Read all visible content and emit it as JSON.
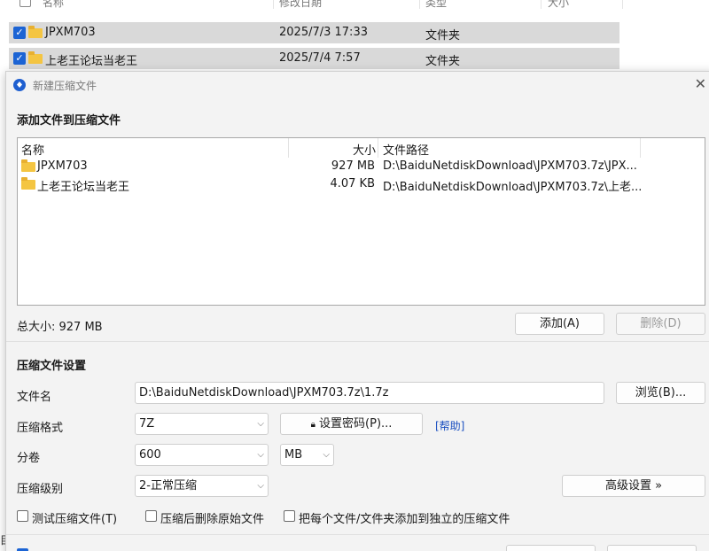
{
  "explorer": {
    "headers": {
      "name": "名称",
      "modified": "修改日期",
      "type": "类型",
      "size": "大小"
    },
    "rows": [
      {
        "name": "JPXM703",
        "modified": "2025/7/3 17:33",
        "type": "文件夹",
        "checked": true
      },
      {
        "name": "上老王论坛当老王",
        "modified": "2025/7/4 7:57",
        "type": "文件夹",
        "checked": true
      }
    ],
    "side_char": "目"
  },
  "dialog": {
    "title": "新建压缩文件",
    "add_section": "添加文件到压缩文件",
    "file_list": {
      "columns": {
        "name": "名称",
        "size": "大小",
        "path": "文件路径"
      },
      "rows": [
        {
          "name": "JPXM703",
          "size": "927 MB",
          "path": "D:\\BaiduNetdiskDownload\\JPXM703.7z\\JPX..."
        },
        {
          "name": "上老王论坛当老王",
          "size": "4.07 KB",
          "path": "D:\\BaiduNetdiskDownload\\JPXM703.7z\\上老..."
        }
      ]
    },
    "total_size": "总大小: 927 MB",
    "buttons": {
      "add": "添加(A)",
      "delete": "删除(D)",
      "browse": "浏览(B)...",
      "set_password": "设置密码(P)...",
      "advanced": "高级设置 »"
    },
    "settings_section": "压缩文件设置",
    "filename_label": "文件名",
    "filename_value": "D:\\BaiduNetdiskDownload\\JPXM703.7z\\1.7z",
    "format_label": "压缩格式",
    "format_value": "7Z",
    "help_link": "[帮助]",
    "volume_label": "分卷",
    "volume_value": "600",
    "volume_unit": "MB",
    "level_label": "压缩级别",
    "level_value": "2-正常压缩",
    "options": [
      {
        "label": "测试压缩文件(T)",
        "checked": false
      },
      {
        "label": "压缩后删除原始文件",
        "checked": false
      },
      {
        "label": "把每个文件/文件夹添加到独立的压缩文件",
        "checked": false
      }
    ]
  }
}
